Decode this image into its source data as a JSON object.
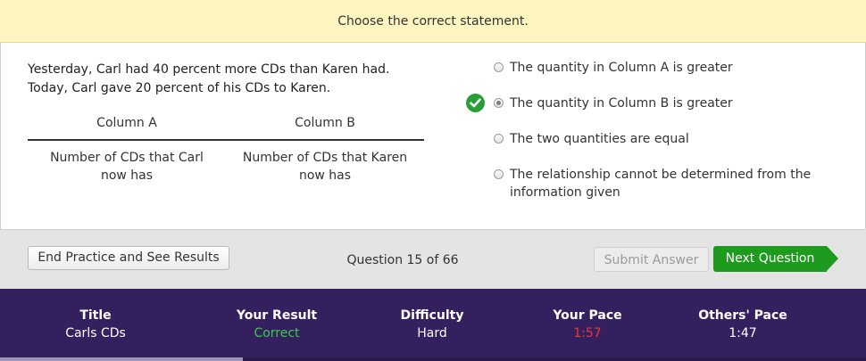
{
  "banner": {
    "instruction": "Choose the correct statement."
  },
  "question": {
    "line1": "Yesterday, Carl had 40 percent more CDs than Karen had.",
    "line2": "Today, Carl gave 20 percent of his CDs to Karen.",
    "column_a_header": "Column A",
    "column_b_header": "Column B",
    "column_a_value": "Number of CDs that Carl now has",
    "column_b_value": "Number of CDs that Karen now has"
  },
  "answers": [
    {
      "label": "The quantity in Column A is greater",
      "selected": false,
      "correct": false
    },
    {
      "label": "The quantity in Column B is greater",
      "selected": true,
      "correct": true
    },
    {
      "label": "The two quantities are equal",
      "selected": false,
      "correct": false
    },
    {
      "label": "The relationship cannot be determined from the information given",
      "selected": false,
      "correct": false
    }
  ],
  "toolbar": {
    "end_label": "End Practice and See Results",
    "question_counter": "Question 15 of 66",
    "submit_label": "Submit Answer",
    "next_label": "Next Question"
  },
  "stats": {
    "title_label": "Title",
    "title_value": "Carls CDs",
    "result_label": "Your Result",
    "result_value": "Correct",
    "difficulty_label": "Difficulty",
    "difficulty_value": "Hard",
    "your_pace_label": "Your Pace",
    "your_pace_value": "1:57",
    "others_pace_label": "Others' Pace",
    "others_pace_value": "1:47"
  },
  "progress": {
    "fraction": 0.28
  },
  "colors": {
    "banner_bg": "#fdf4c0",
    "next_button": "#1e9a1e",
    "footer_bg": "#35205f",
    "correct_text": "#3fc84e",
    "slow_pace_text": "#e43a3a",
    "check_badge": "#2a9d39"
  }
}
